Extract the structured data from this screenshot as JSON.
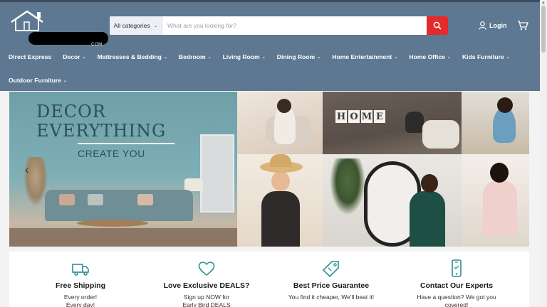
{
  "header": {
    "logo_text": ".COM",
    "search": {
      "category_label": "All categories",
      "placeholder": "What are you looking for?"
    },
    "login_label": "Login",
    "nav": [
      {
        "label": "Direct Express",
        "has_dropdown": false
      },
      {
        "label": "Decor",
        "has_dropdown": true
      },
      {
        "label": "Mattresses & Bedding",
        "has_dropdown": true
      },
      {
        "label": "Bedroom",
        "has_dropdown": true
      },
      {
        "label": "Living Room",
        "has_dropdown": true
      },
      {
        "label": "Dining Room",
        "has_dropdown": true
      },
      {
        "label": "Home Entertainment",
        "has_dropdown": true
      },
      {
        "label": "Home Office",
        "has_dropdown": true
      },
      {
        "label": "Kids Furniture",
        "has_dropdown": true
      }
    ],
    "nav_row2": {
      "label": "Outdoor Furniture",
      "has_dropdown": true
    }
  },
  "hero": {
    "headline_line1": "DECOR",
    "headline_line2": "EVERYTHING",
    "subheadline": "CREATE YOU",
    "tile_text": "HOME"
  },
  "features": [
    {
      "icon": "truck-icon",
      "title": "Free Shipping",
      "sub1": "Every order!",
      "sub2": "Every day!"
    },
    {
      "icon": "heart-icon",
      "title": "Love Exclusive DEALS?",
      "sub1": "Sign up NOW for",
      "sub2": "Early Bird DEALS"
    },
    {
      "icon": "price-tag-icon",
      "title": "Best Price Guarantee",
      "sub1": "You find it cheaper, We'll beat it!",
      "sub2": ""
    },
    {
      "icon": "phone-icon",
      "title": "Contact Our Experts",
      "sub1": "Have a question? We got you",
      "sub2": "covered!"
    }
  ],
  "colors": {
    "header_bg": "#5d7890",
    "search_button": "#e32b2b",
    "icon_accent": "#2a8f93"
  }
}
